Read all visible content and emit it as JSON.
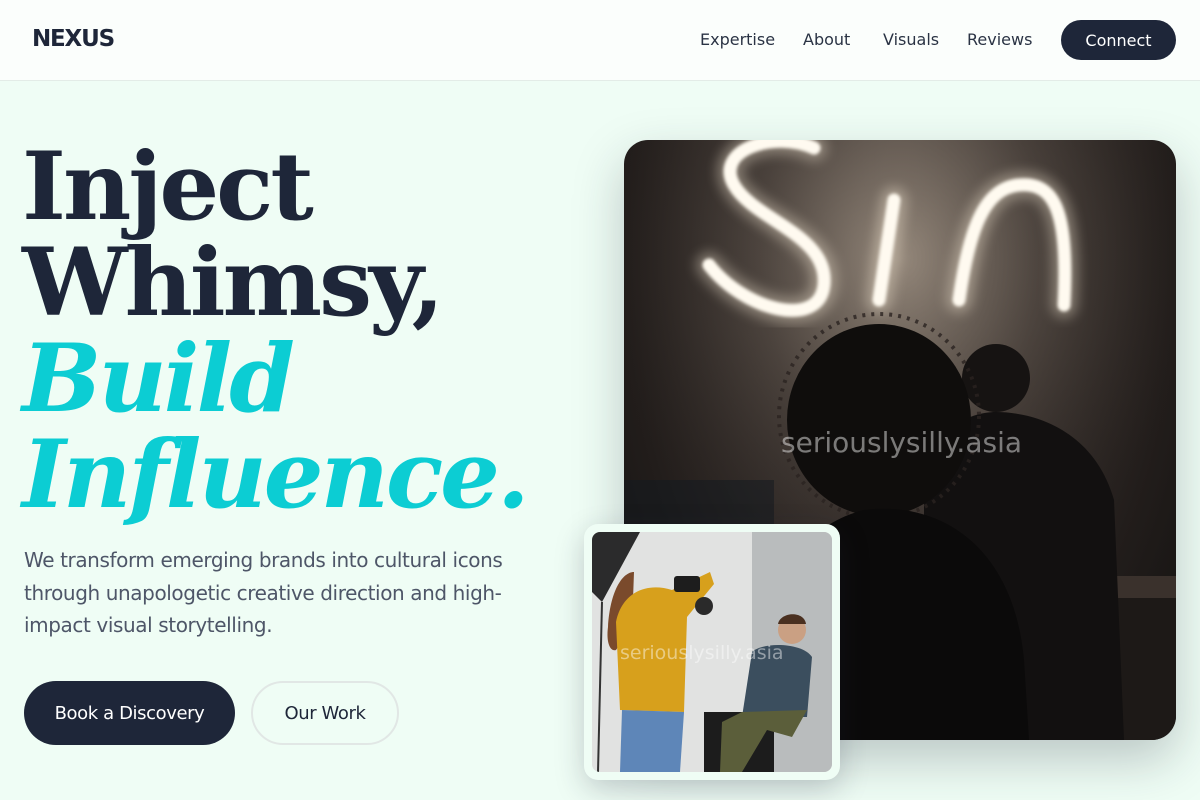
{
  "header": {
    "logo": "NEXUS",
    "nav": [
      "Expertise",
      "About",
      "Visuals",
      "Reviews"
    ],
    "cta": "Connect"
  },
  "hero": {
    "line1": "Inject",
    "line2": "Whimsy,",
    "line3": "Build",
    "line4": "Influence.",
    "subtitle": "We transform emerging brands into cultural icons through unapologetic creative direction and high-impact visual storytelling.",
    "primary_button": "Book a Discovery",
    "secondary_button": "Our Work"
  },
  "images": {
    "main_watermark": "seriouslysilly.asia",
    "inset_watermark": "seriouslysilly.asia"
  },
  "colors": {
    "background": "#effdf5",
    "header_bg": "#fbfefc",
    "navy": "#1e2639",
    "accent": "#0ccdd3",
    "body_text": "#4e5668"
  }
}
